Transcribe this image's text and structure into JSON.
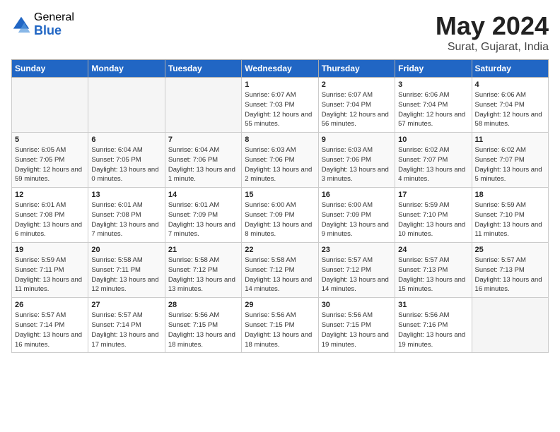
{
  "logo": {
    "general": "General",
    "blue": "Blue"
  },
  "title": "May 2024",
  "location": "Surat, Gujarat, India",
  "days_of_week": [
    "Sunday",
    "Monday",
    "Tuesday",
    "Wednesday",
    "Thursday",
    "Friday",
    "Saturday"
  ],
  "weeks": [
    [
      {
        "day": "",
        "empty": true
      },
      {
        "day": "",
        "empty": true
      },
      {
        "day": "",
        "empty": true
      },
      {
        "day": "1",
        "sunrise": "6:07 AM",
        "sunset": "7:03 PM",
        "daylight": "12 hours and 55 minutes."
      },
      {
        "day": "2",
        "sunrise": "6:07 AM",
        "sunset": "7:04 PM",
        "daylight": "12 hours and 56 minutes."
      },
      {
        "day": "3",
        "sunrise": "6:06 AM",
        "sunset": "7:04 PM",
        "daylight": "12 hours and 57 minutes."
      },
      {
        "day": "4",
        "sunrise": "6:06 AM",
        "sunset": "7:04 PM",
        "daylight": "12 hours and 58 minutes."
      }
    ],
    [
      {
        "day": "5",
        "sunrise": "6:05 AM",
        "sunset": "7:05 PM",
        "daylight": "12 hours and 59 minutes."
      },
      {
        "day": "6",
        "sunrise": "6:04 AM",
        "sunset": "7:05 PM",
        "daylight": "13 hours and 0 minutes."
      },
      {
        "day": "7",
        "sunrise": "6:04 AM",
        "sunset": "7:06 PM",
        "daylight": "13 hours and 1 minute."
      },
      {
        "day": "8",
        "sunrise": "6:03 AM",
        "sunset": "7:06 PM",
        "daylight": "13 hours and 2 minutes."
      },
      {
        "day": "9",
        "sunrise": "6:03 AM",
        "sunset": "7:06 PM",
        "daylight": "13 hours and 3 minutes."
      },
      {
        "day": "10",
        "sunrise": "6:02 AM",
        "sunset": "7:07 PM",
        "daylight": "13 hours and 4 minutes."
      },
      {
        "day": "11",
        "sunrise": "6:02 AM",
        "sunset": "7:07 PM",
        "daylight": "13 hours and 5 minutes."
      }
    ],
    [
      {
        "day": "12",
        "sunrise": "6:01 AM",
        "sunset": "7:08 PM",
        "daylight": "13 hours and 6 minutes."
      },
      {
        "day": "13",
        "sunrise": "6:01 AM",
        "sunset": "7:08 PM",
        "daylight": "13 hours and 7 minutes."
      },
      {
        "day": "14",
        "sunrise": "6:01 AM",
        "sunset": "7:09 PM",
        "daylight": "13 hours and 7 minutes."
      },
      {
        "day": "15",
        "sunrise": "6:00 AM",
        "sunset": "7:09 PM",
        "daylight": "13 hours and 8 minutes."
      },
      {
        "day": "16",
        "sunrise": "6:00 AM",
        "sunset": "7:09 PM",
        "daylight": "13 hours and 9 minutes."
      },
      {
        "day": "17",
        "sunrise": "5:59 AM",
        "sunset": "7:10 PM",
        "daylight": "13 hours and 10 minutes."
      },
      {
        "day": "18",
        "sunrise": "5:59 AM",
        "sunset": "7:10 PM",
        "daylight": "13 hours and 11 minutes."
      }
    ],
    [
      {
        "day": "19",
        "sunrise": "5:59 AM",
        "sunset": "7:11 PM",
        "daylight": "13 hours and 11 minutes."
      },
      {
        "day": "20",
        "sunrise": "5:58 AM",
        "sunset": "7:11 PM",
        "daylight": "13 hours and 12 minutes."
      },
      {
        "day": "21",
        "sunrise": "5:58 AM",
        "sunset": "7:12 PM",
        "daylight": "13 hours and 13 minutes."
      },
      {
        "day": "22",
        "sunrise": "5:58 AM",
        "sunset": "7:12 PM",
        "daylight": "13 hours and 14 minutes."
      },
      {
        "day": "23",
        "sunrise": "5:57 AM",
        "sunset": "7:12 PM",
        "daylight": "13 hours and 14 minutes."
      },
      {
        "day": "24",
        "sunrise": "5:57 AM",
        "sunset": "7:13 PM",
        "daylight": "13 hours and 15 minutes."
      },
      {
        "day": "25",
        "sunrise": "5:57 AM",
        "sunset": "7:13 PM",
        "daylight": "13 hours and 16 minutes."
      }
    ],
    [
      {
        "day": "26",
        "sunrise": "5:57 AM",
        "sunset": "7:14 PM",
        "daylight": "13 hours and 16 minutes."
      },
      {
        "day": "27",
        "sunrise": "5:57 AM",
        "sunset": "7:14 PM",
        "daylight": "13 hours and 17 minutes."
      },
      {
        "day": "28",
        "sunrise": "5:56 AM",
        "sunset": "7:15 PM",
        "daylight": "13 hours and 18 minutes."
      },
      {
        "day": "29",
        "sunrise": "5:56 AM",
        "sunset": "7:15 PM",
        "daylight": "13 hours and 18 minutes."
      },
      {
        "day": "30",
        "sunrise": "5:56 AM",
        "sunset": "7:15 PM",
        "daylight": "13 hours and 19 minutes."
      },
      {
        "day": "31",
        "sunrise": "5:56 AM",
        "sunset": "7:16 PM",
        "daylight": "13 hours and 19 minutes."
      },
      {
        "day": "",
        "empty": true
      }
    ]
  ],
  "labels": {
    "sunrise": "Sunrise:",
    "sunset": "Sunset:",
    "daylight": "Daylight:"
  }
}
